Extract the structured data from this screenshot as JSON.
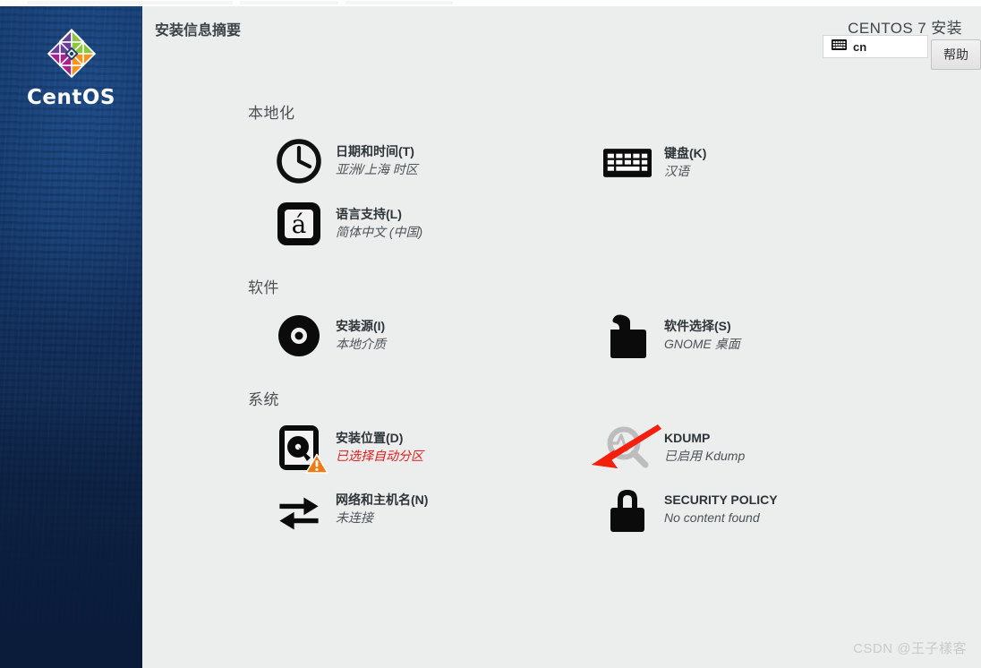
{
  "window": {
    "product_title": "CENTOS 7 安装",
    "page_title": "安装信息摘要"
  },
  "header": {
    "keyboard_layout": "cn",
    "keyboard_icon": "keyboard-icon",
    "help_label": "帮助"
  },
  "branding": {
    "logo_text": "CentOS",
    "logo_icon": "centos-logo-icon"
  },
  "sections": [
    {
      "id": "localization",
      "title": "本地化",
      "items": [
        {
          "id": "date-time",
          "icon": "clock-icon",
          "name": "日期和时间(T)",
          "status": "亚洲/上海 时区",
          "warning": false
        },
        {
          "id": "keyboard",
          "icon": "keyboard-icon",
          "name": "键盘(K)",
          "status": "汉语",
          "warning": false
        },
        {
          "id": "language-support",
          "icon": "language-icon",
          "name": "语言支持(L)",
          "status": "简体中文 (中国)",
          "warning": false
        }
      ]
    },
    {
      "id": "software",
      "title": "软件",
      "items": [
        {
          "id": "installation-source",
          "icon": "disc-icon",
          "name": "安装源(I)",
          "status": "本地介质",
          "warning": false
        },
        {
          "id": "software-selection",
          "icon": "package-icon",
          "name": "软件选择(S)",
          "status": "GNOME 桌面",
          "warning": false
        }
      ]
    },
    {
      "id": "system",
      "title": "系统",
      "items": [
        {
          "id": "installation-destination",
          "icon": "harddisk-icon",
          "name": "安装位置(D)",
          "status": "已选择自动分区",
          "warning": true
        },
        {
          "id": "kdump",
          "icon": "magnifier-waveform-icon",
          "name": "KDUMP",
          "status": "已启用 Kdump",
          "warning": false
        },
        {
          "id": "network-hostname",
          "icon": "network-arrows-icon",
          "name": "网络和主机名(N)",
          "status": "未连接",
          "warning": false
        },
        {
          "id": "security-policy",
          "icon": "lock-icon",
          "name": "SECURITY POLICY",
          "status": "No content found",
          "warning": false
        }
      ]
    }
  ],
  "annotation": {
    "arrow_color": "#f41f0d",
    "points_to": "installation-destination"
  },
  "watermark": {
    "text": "CSDN @王子樣客"
  },
  "colors": {
    "sidebar_top": "#143a70",
    "sidebar_bottom": "#0b2042",
    "content_bg": "#eceded",
    "warning_orange": "#f07b12",
    "warning_red": "#e01b1b",
    "text_primary": "#2e3538",
    "text_secondary": "#4d5457"
  }
}
